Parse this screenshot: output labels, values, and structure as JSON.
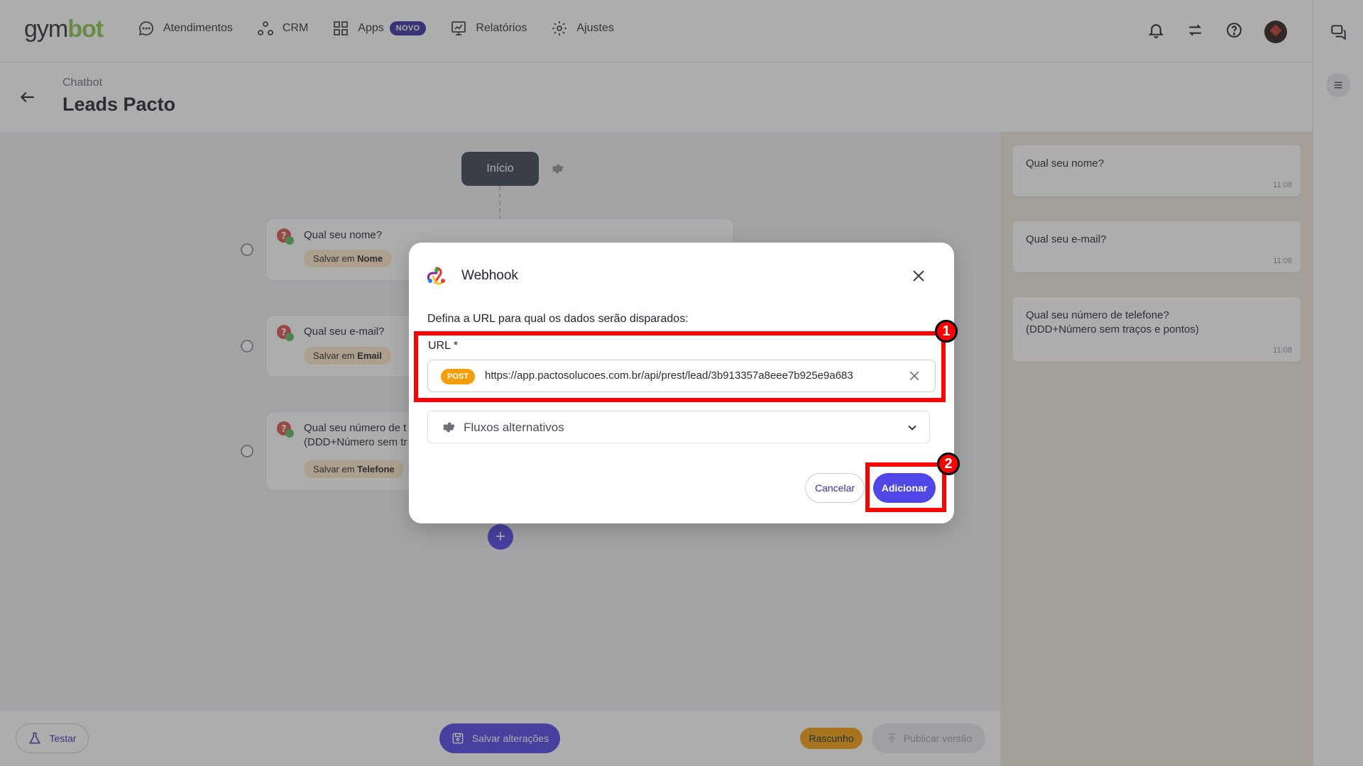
{
  "app": {
    "logo_gym": "gym",
    "logo_bot": "bot"
  },
  "nav": {
    "items": [
      {
        "label": "Atendimentos",
        "icon": "chat-bubble-icon"
      },
      {
        "label": "CRM",
        "icon": "crm-nodes-icon"
      },
      {
        "label": "Apps",
        "icon": "grid-icon",
        "badge": "NOVO"
      },
      {
        "label": "Relatórios",
        "icon": "report-chart-icon"
      },
      {
        "label": "Ajustes",
        "icon": "gear-icon"
      }
    ]
  },
  "header": {
    "breadcrumb": "Chatbot",
    "title": "Leads Pacto"
  },
  "flow": {
    "start_label": "Início",
    "cards": [
      {
        "question": "Qual seu nome?",
        "save_prefix": "Salvar em",
        "save_field": "Nome"
      },
      {
        "question": "Qual seu e-mail?",
        "save_prefix": "Salvar em",
        "save_field": "Email"
      },
      {
        "question_line1": "Qual seu número de t",
        "question_line2": "(DDD+Número sem tr",
        "save_prefix": "Salvar em",
        "save_field": "Telefone"
      }
    ],
    "add_symbol": "+"
  },
  "preview": {
    "messages": [
      {
        "text": "Qual seu nome?",
        "time": "11:08"
      },
      {
        "text": "Qual seu e-mail?",
        "time": "11:08"
      },
      {
        "line1": "Qual seu número de telefone?",
        "line2": "(DDD+Número sem traços e pontos)",
        "time": "11:08"
      }
    ]
  },
  "bottombar": {
    "test_label": "Testar",
    "save_label": "Salvar alterações",
    "draft_label": "Rascunho",
    "publish_label": "Publicar versão"
  },
  "modal": {
    "title": "Webhook",
    "description": "Defina a URL para qual os dados serão disparados:",
    "url_label": "URL *",
    "method": "POST",
    "url_value": "https://app.pactosolucoes.com.br/api/prest/lead/3b913357a8eee7b925e9a683",
    "alt_flows_label": "Fluxos alternativos",
    "cancel_label": "Cancelar",
    "add_label": "Adicionar"
  },
  "annotations": {
    "step1": "1",
    "step2": "2"
  },
  "colors": {
    "accent": "#4f46e5",
    "brand_green": "#8bc34a",
    "badge_new": "#3730a3",
    "post_badge": "#f59e0b",
    "save_tag": "#fde8c8",
    "highlight": "#ff0000"
  }
}
